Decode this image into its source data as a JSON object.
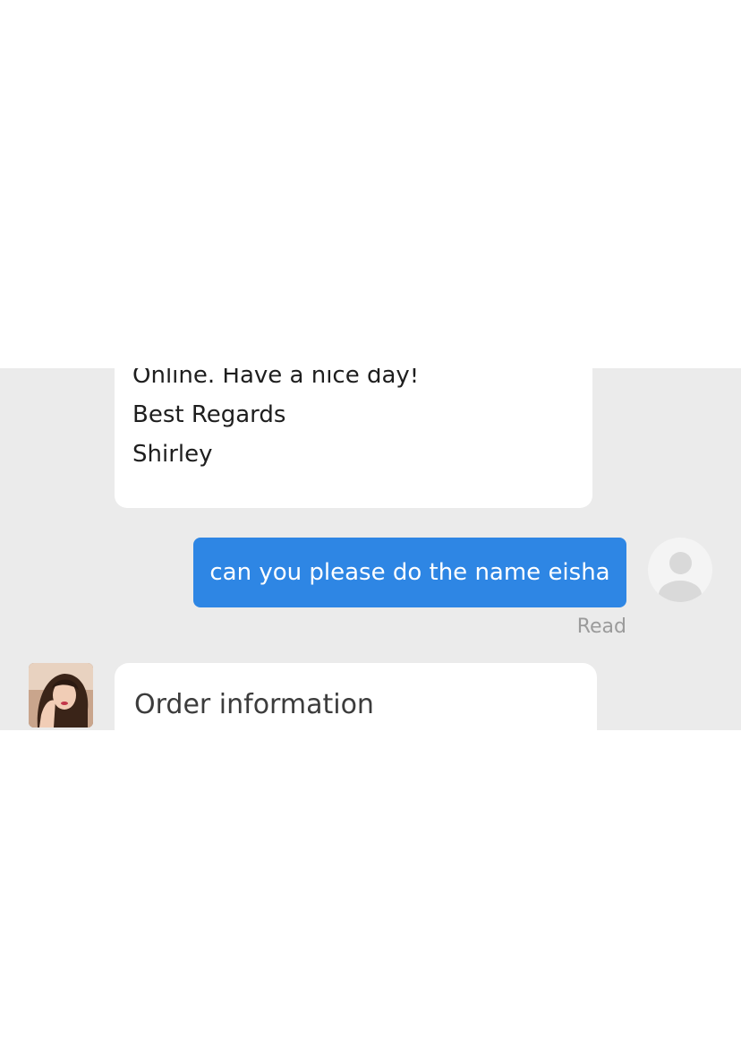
{
  "chat": {
    "incoming_message": {
      "partial_line": "",
      "lines": [
        "Online. Have a nice day!",
        "Best Regards",
        "Shirley"
      ]
    },
    "outgoing_message": {
      "text": "can you please do the name eisha",
      "status": "Read"
    },
    "order_card": {
      "title": "Order information"
    }
  },
  "colors": {
    "chat_background": "#ebebeb",
    "outgoing_bubble": "#2e86e4",
    "incoming_bubble": "#ffffff",
    "status_text": "#9b9b9b"
  },
  "icons": {
    "self_avatar": "default-user-avatar-icon",
    "agent_avatar": "agent-profile-photo"
  }
}
